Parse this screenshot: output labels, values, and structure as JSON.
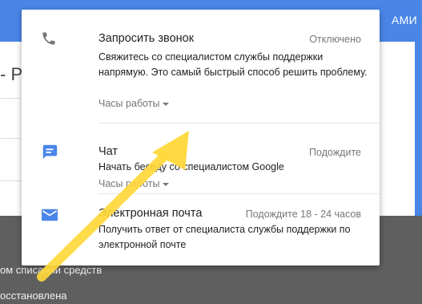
{
  "background": {
    "top_bar_text": "АМИ",
    "left_title": "- Р",
    "footer_lines": [
      "ом списании средств",
      "осстановлена"
    ]
  },
  "options": [
    {
      "icon": "phone-icon",
      "title": "Запросить звонок",
      "status": "Отключено",
      "description": "Свяжитесь со специалистом службы поддержки напрямую. Это самый быстрый способ решить проблему.",
      "hours_label": "Часы работы"
    },
    {
      "icon": "chat-icon",
      "title": "Чат",
      "status": "Подождите",
      "description": "Начать беседу со специалистом Google",
      "hours_label": "Часы работы"
    },
    {
      "icon": "mail-icon",
      "title": "Электронная почта",
      "status": "Подождите 18 - 24 часов",
      "description": "Получить ответ от специалиста службы поддержки по электронной почте"
    }
  ],
  "colors": {
    "accent_blue": "#4a86e8",
    "arrow_yellow": "#ffd83b",
    "footer_gray": "#5f5f5f"
  }
}
